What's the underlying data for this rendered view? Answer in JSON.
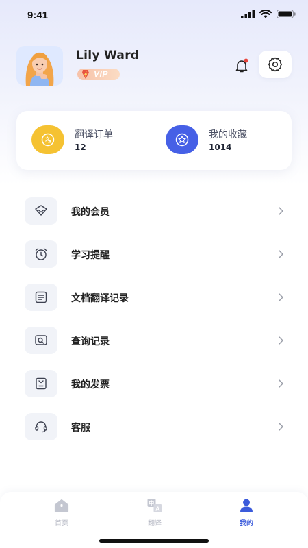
{
  "status_bar": {
    "time": "9:41"
  },
  "profile": {
    "name": "Lily Ward",
    "vip_label": "VIP"
  },
  "stats": [
    {
      "label": "翻译订单",
      "value": "12",
      "color": "#f5c232"
    },
    {
      "label": "我的收藏",
      "value": "1014",
      "color": "#4660e6"
    }
  ],
  "menu": [
    {
      "label": "我的会员",
      "icon": "diamond-icon"
    },
    {
      "label": "学习提醒",
      "icon": "alarm-clock-icon"
    },
    {
      "label": "文档翻译记录",
      "icon": "document-icon"
    },
    {
      "label": "查询记录",
      "icon": "search-record-icon"
    },
    {
      "label": "我的发票",
      "icon": "invoice-icon"
    },
    {
      "label": "客服",
      "icon": "headset-icon"
    }
  ],
  "tabs": [
    {
      "label": "首页",
      "icon": "home-icon",
      "active": false
    },
    {
      "label": "翻译",
      "icon": "translate-icon",
      "active": false
    },
    {
      "label": "我的",
      "icon": "profile-icon",
      "active": true
    }
  ],
  "colors": {
    "accent": "#3b5bdb",
    "yellow": "#f5c232",
    "notification_dot": "#e8453c"
  }
}
